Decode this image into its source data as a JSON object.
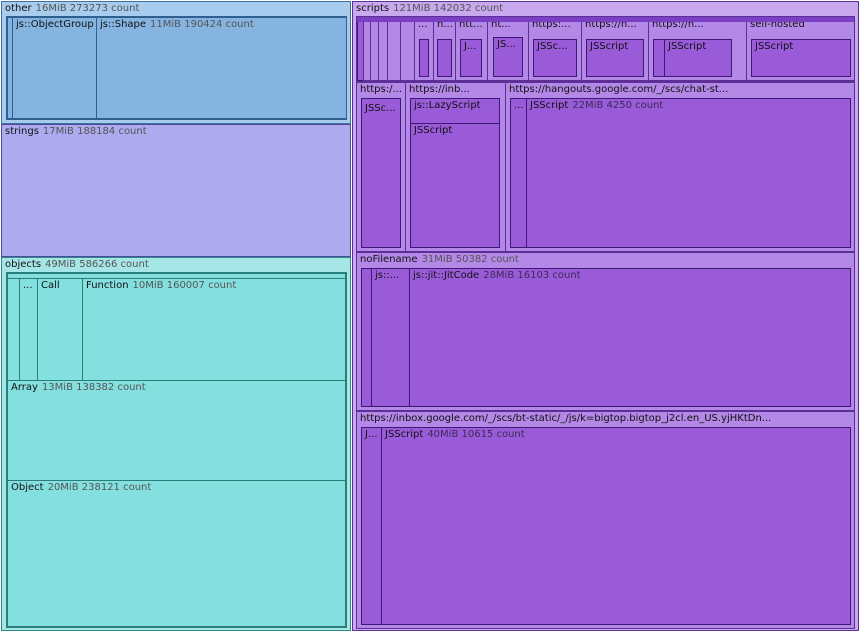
{
  "other": {
    "label": "other",
    "meta": "16MiB 273273 count",
    "children": [
      {
        "label": "js::ObjectGroup",
        "meta": ""
      },
      {
        "label": "js::Shape",
        "meta": "11MiB 190424 count"
      }
    ]
  },
  "strings": {
    "label": "strings",
    "meta": "17MiB 188184 count"
  },
  "objects": {
    "label": "objects",
    "meta": "49MiB 586266 count",
    "children": [
      {
        "label": "...",
        "meta": ""
      },
      {
        "label": "Call",
        "meta": ""
      },
      {
        "label": "Function",
        "meta": "10MiB 160007 count"
      },
      {
        "label": "Array",
        "meta": "13MiB 138382 count"
      },
      {
        "label": "Object",
        "meta": "20MiB 238121 count"
      }
    ]
  },
  "scripts": {
    "label": "scripts",
    "meta": "121MiB 142032 count",
    "row1": [
      {
        "label": "...",
        "inner": ""
      },
      {
        "label": "h...",
        "inner": ""
      },
      {
        "label": "htt...",
        "inner": "J..."
      },
      {
        "label": "ht...",
        "inner": "JS..."
      },
      {
        "label": "https:...",
        "inner": "JSSc..."
      },
      {
        "label": "https://n...",
        "inner": "JSScript"
      },
      {
        "label": "https://h...",
        "inner": "JSScript"
      },
      {
        "label": "self-hosted",
        "inner": "JSScript"
      }
    ],
    "row2": {
      "a": {
        "label": "https:/...",
        "inner": "JSSc..."
      },
      "b": {
        "label": "https://inb...",
        "inner1": "js::LazyScript",
        "inner2": "JSScript"
      },
      "c": {
        "label": "https://hangouts.google.com/_/scs/chat-st...",
        "inner0": "...",
        "inner": "JSScript",
        "meta": "22MiB 4250 count"
      }
    },
    "nofile": {
      "label": "noFilename",
      "meta": "31MiB 50382 count",
      "c1": "js::...",
      "c2": "js::jit::JitCode",
      "c2meta": "28MiB 16103 count"
    },
    "inbox": {
      "label": "https://inbox.google.com/_/scs/bt-static/_/js/k=bigtop.bigtop_j2cl.en_US.yjHKtDn...",
      "c1": "J...",
      "c2": "JSScript",
      "c2meta": "40MiB 10615 count"
    }
  }
}
